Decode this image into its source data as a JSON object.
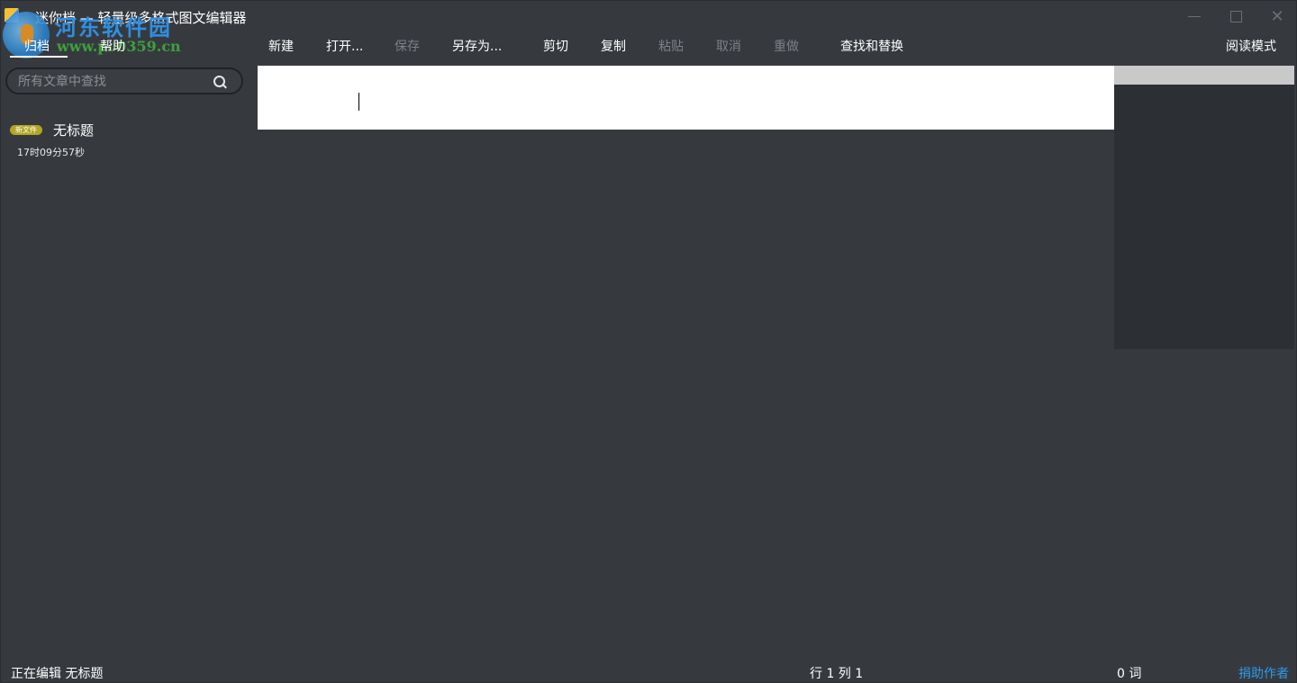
{
  "window": {
    "title": "迷你档 — 轻量级多格式图文编辑器"
  },
  "watermark": {
    "name": "河东软件园",
    "url": "www.pc0359.cn"
  },
  "left_tabs": [
    {
      "label": "归档",
      "active": true
    },
    {
      "label": "帮助",
      "active": false
    }
  ],
  "toolbar": {
    "new": "新建",
    "open": "打开...",
    "save": "保存",
    "save_as": "另存为...",
    "cut": "剪切",
    "copy": "复制",
    "paste": "粘贴",
    "undo": "取消",
    "redo": "重做",
    "find_replace": "查找和替换",
    "reading_mode": "阅读模式"
  },
  "search": {
    "placeholder": "所有文章中查找",
    "value": ""
  },
  "documents": [
    {
      "badge": "新文件",
      "title": "无标题",
      "time": "17时09分57秒"
    }
  ],
  "status": {
    "editing": "正在编辑 无标题",
    "position": "行 1 列 1",
    "words": "0 词",
    "donate": "捐助作者"
  },
  "colors": {
    "background": "#363a3f",
    "badge": "#b3a623",
    "link": "#2d9bea",
    "disabled": "#7d8187"
  }
}
